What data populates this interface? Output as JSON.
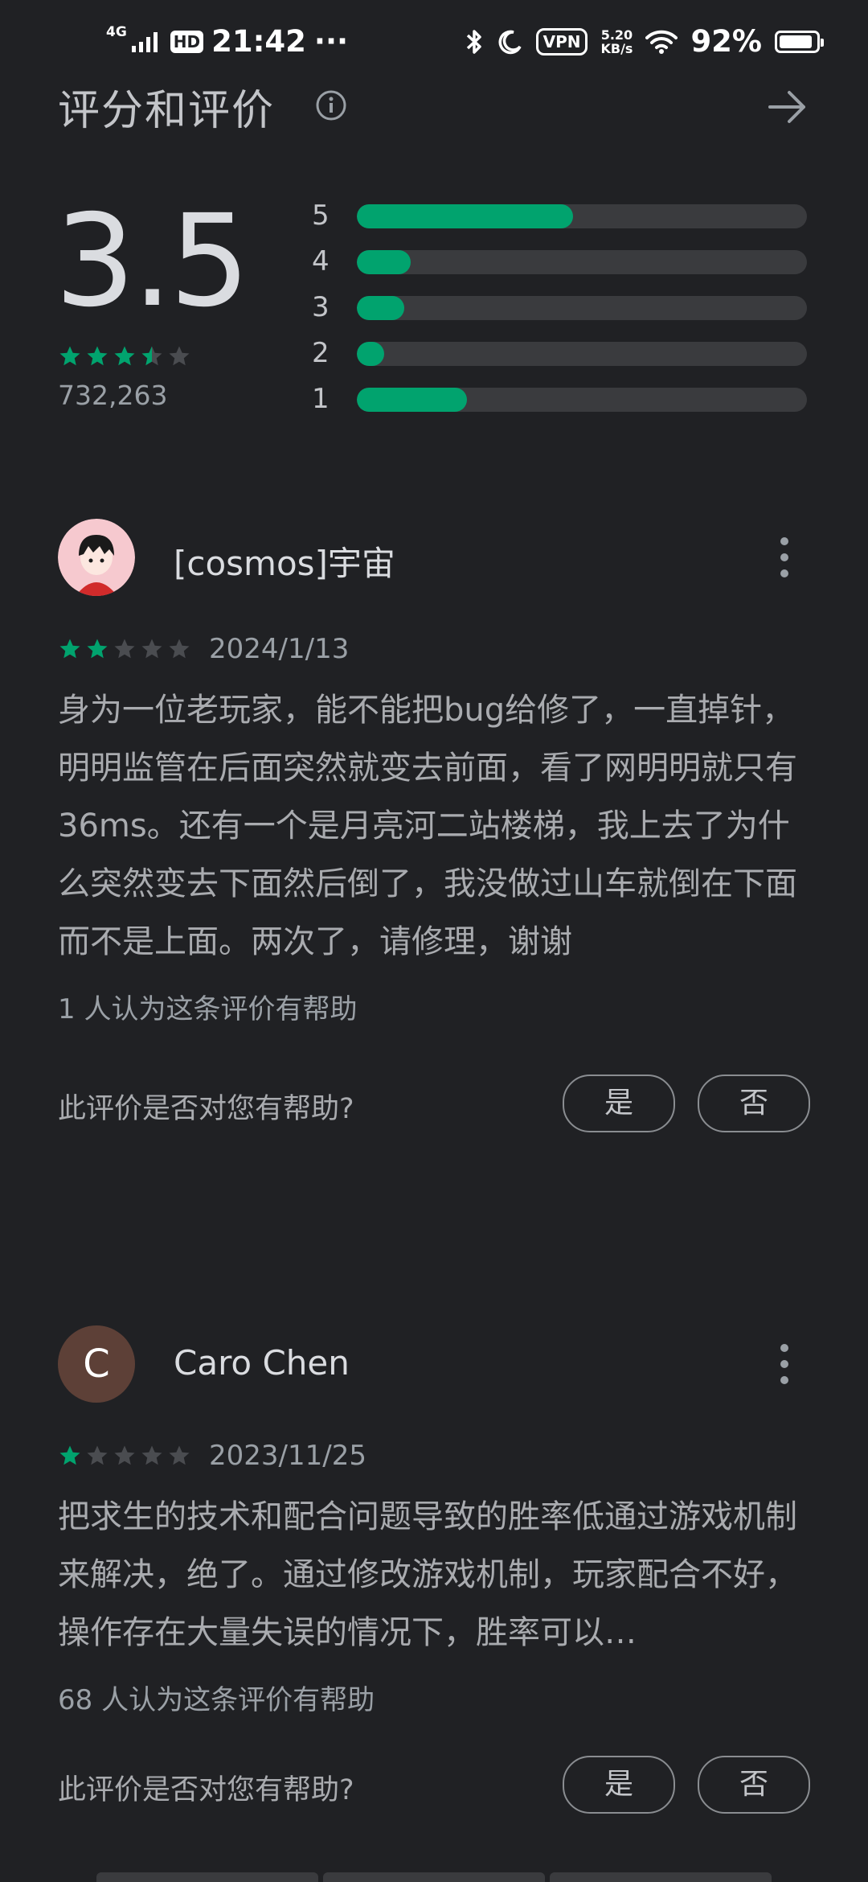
{
  "status_bar": {
    "network": "4G",
    "hd": "HD",
    "time": "21:42",
    "more": "···",
    "vpn": "VPN",
    "speed_value": "5.20",
    "speed_unit": "KB/s",
    "battery": "92%"
  },
  "header": {
    "title": "评分和评价"
  },
  "summary": {
    "average": "3.5",
    "average_stars": 3.5,
    "total": "732,263",
    "distribution": [
      {
        "label": "5",
        "fraction": 0.48
      },
      {
        "label": "4",
        "fraction": 0.12
      },
      {
        "label": "3",
        "fraction": 0.105
      },
      {
        "label": "2",
        "fraction": 0.06
      },
      {
        "label": "1",
        "fraction": 0.245
      }
    ]
  },
  "reviews": [
    {
      "name": "[cosmos]宇宙",
      "stars": 2,
      "date": "2024/1/13",
      "body": "身为一位老玩家，能不能把bug给修了，一直掉针，明明监管在后面突然就变去前面，看了网明明就只有36ms。还有一个是月亮河二站楼梯，我上去了为什么突然变去下面然后倒了，我没做过山车就倒在下面而不是上面。两次了，请修理，谢谢",
      "helpful": "1 人认为这条评价有帮助",
      "ask": "此评价是否对您有帮助?",
      "yes": "是",
      "no": "否"
    },
    {
      "name": "Caro Chen",
      "avatar_letter": "C",
      "stars": 1,
      "date": "2023/11/25",
      "body": "把求生的技术和配合问题导致的胜率低通过游戏机制来解决，绝了。通过修改游戏机制，玩家配合不好，操作存在大量失误的情况下，胜率可以…",
      "helpful": "68 人认为这条评价有帮助",
      "ask": "此评价是否对您有帮助?",
      "yes": "是",
      "no": "否"
    }
  ],
  "colors": {
    "background": "#202124",
    "accent_green": "#01a36e",
    "track": "#3a3b3e",
    "star_empty": "#4a4c50"
  }
}
